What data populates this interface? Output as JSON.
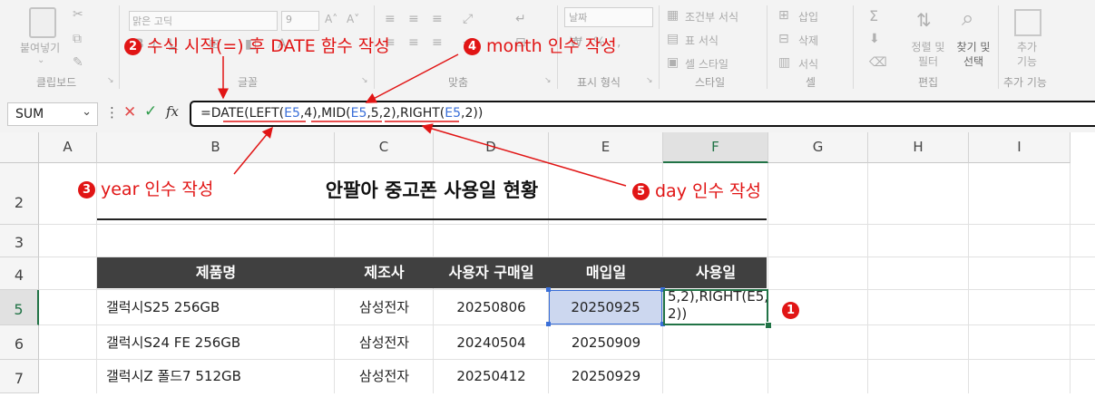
{
  "ribbon": {
    "clipboard": {
      "paste_label": "붙여넣기",
      "group_label": "클립보드"
    },
    "font": {
      "font_name": "맑은 고딕",
      "font_size": "9",
      "group_label": "글꼴"
    },
    "alignment": {
      "group_label": "맞춤"
    },
    "number": {
      "format_value": "날짜",
      "group_label": "표시 형식"
    },
    "styles": {
      "conditional_label": "조건부 서식",
      "table_label": "표 서식",
      "cell_styles_label": "셀 스타일",
      "group_label": "스타일"
    },
    "cells": {
      "insert_label": "삽입",
      "delete_label": "삭제",
      "format_label": "서식",
      "group_label": "셀"
    },
    "editing": {
      "sort_label": "정렬 및 필터",
      "find_label": "찾기 및 선택",
      "group_label": "편집"
    },
    "addins": {
      "addins_label": "추가 기능",
      "group_label": "추가 기능"
    }
  },
  "formula_bar": {
    "name_box": "SUM",
    "fx": "fx",
    "formula_parts": [
      {
        "t": "=DATE(LEFT(",
        "c": "#222222"
      },
      {
        "t": "E5",
        "c": "#3a6fd8"
      },
      {
        "t": ",4),MID(",
        "c": "#222222"
      },
      {
        "t": "E5",
        "c": "#3a6fd8"
      },
      {
        "t": ",5,2),RIGHT(",
        "c": "#222222"
      },
      {
        "t": "E5",
        "c": "#3a6fd8"
      },
      {
        "t": ",2))",
        "c": "#222222"
      }
    ]
  },
  "sheet": {
    "columns": [
      "A",
      "B",
      "C",
      "D",
      "E",
      "F",
      "G",
      "H",
      "I"
    ],
    "rows": [
      "2",
      "3",
      "4",
      "5",
      "6",
      "7"
    ],
    "title": "안팔아 중고폰 사용일 현황",
    "headers": [
      "제품명",
      "제조사",
      "사용자 구매일",
      "매입일",
      "사용일"
    ],
    "data": [
      [
        "갤럭시S25 256GB",
        "삼성전자",
        "20250806",
        "20250925"
      ],
      [
        "갤럭시S24 FE 256GB",
        "삼성전자",
        "20240504",
        "20250909"
      ],
      [
        "갤럭시Z 폴드7 512GB",
        "삼성전자",
        "20250412",
        "20250929"
      ]
    ],
    "editing_text_line1": "5,2),RIGHT(E5,",
    "editing_text_line2": "2))"
  },
  "annotations": [
    {
      "num": "❶",
      "text": ""
    },
    {
      "num": "❷",
      "text": "수식 시작(=) 후 DATE 함수 작성"
    },
    {
      "num": "❸",
      "text": "year 인수 작성"
    },
    {
      "num": "❹",
      "text": "month 인수 작성"
    },
    {
      "num": "❺",
      "text": "day 인수 작성"
    }
  ],
  "colors": {
    "header_fill": "#404040",
    "selected_fill": "#ccd7ef",
    "annotation_red": "#e11515",
    "ref_blue": "#3a6fd8"
  }
}
